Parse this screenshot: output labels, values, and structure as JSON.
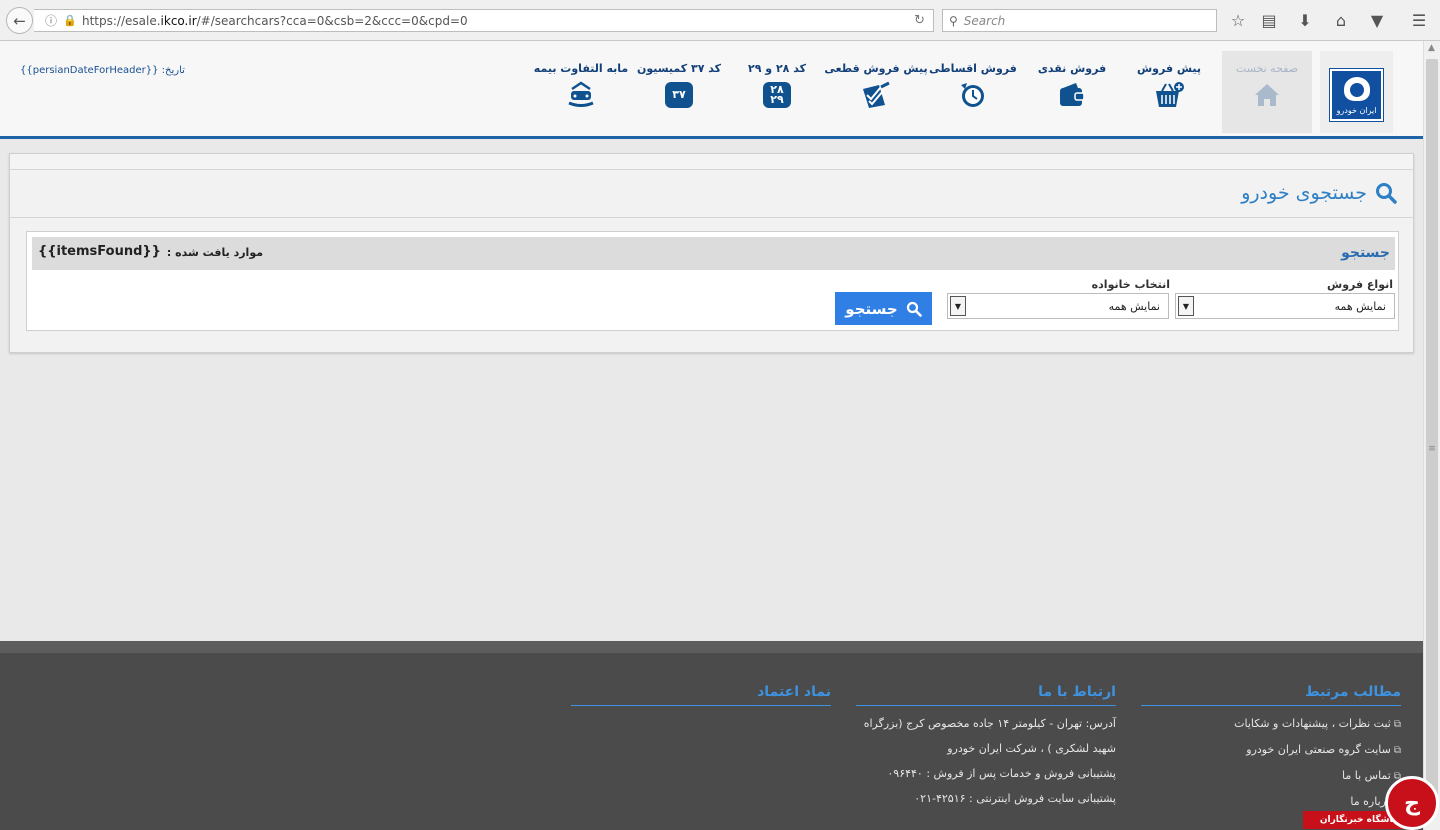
{
  "browser": {
    "url_prefix": "https://esale.",
    "url_domain": "ikco.ir",
    "url_suffix": "/#/searchcars?cca=0&csb=2&ccc=0&cpd=0",
    "search_placeholder": "Search"
  },
  "header": {
    "date_label": "تاریخ: {{persianDateForHeader}}",
    "nav": [
      {
        "label": "صفحه نخست",
        "icon": "home-icon"
      },
      {
        "label": "پیش فروش",
        "icon": "basket-icon"
      },
      {
        "label": "فروش نقدی",
        "icon": "wallet-icon"
      },
      {
        "label": "فروش اقساطی",
        "icon": "clock-icon"
      },
      {
        "label": "پیش فروش قطعی",
        "icon": "checklist-icon"
      },
      {
        "label": "کد ۲۸ و ۲۹",
        "icon": "code-28-29-icon",
        "badge": "۲۸\n۲۹"
      },
      {
        "label": "کد ۳۷ کمیسیون",
        "icon": "code-37-icon",
        "badge": "۳۷"
      },
      {
        "label": "مابه التفاوت بیمه",
        "icon": "car-insurance-icon"
      }
    ],
    "logo_text": "ایران خودرو"
  },
  "panel": {
    "title": "جستجوی خودرو",
    "search": {
      "heading": "جستجو",
      "found_label": "موارد یافت شده :",
      "found_value": "{{itemsFound}}",
      "sale_type_label": "انواع فروش",
      "sale_type_value": "نمایش همه",
      "family_label": "انتخاب خانواده",
      "family_value": "نمایش همه",
      "button_label": "جستجو"
    }
  },
  "footer": {
    "related": {
      "title": "مطالب مرتبط",
      "items": [
        "ثبت نظرات ، پیشنهادات و شکایات",
        "سایت گروه صنعتی ایران خودرو",
        "تماس با ما",
        "درباره ما"
      ]
    },
    "contact": {
      "title": "ارتباط با ما",
      "items": [
        "آدرس: تهران - کیلومتر ۱۴ جاده مخصوص کرج (بزرگراه",
        "شهید لشکری ) ، شرکت ایران خودرو",
        "پشتیبانی فروش و خدمات پس از فروش : ۰۹۶۴۴۰",
        "پشتیبانی سایت فروش اینترنتی : ۴۲۵۱۶-۰۲۱"
      ]
    },
    "trust": {
      "title": "نماد اعتماد"
    }
  },
  "watermark": "باشگاه خبرنگاران"
}
